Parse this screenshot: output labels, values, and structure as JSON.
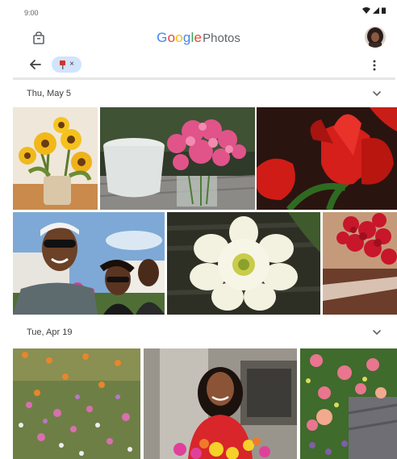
{
  "status_bar": {
    "time": "9:00"
  },
  "app_bar": {
    "logo_letters": [
      {
        "char": "G",
        "color": "#4285F4"
      },
      {
        "char": "o",
        "color": "#EA4335"
      },
      {
        "char": "o",
        "color": "#FBBC05"
      },
      {
        "char": "g",
        "color": "#4285F4"
      },
      {
        "char": "l",
        "color": "#34A853"
      },
      {
        "char": "e",
        "color": "#EA4335"
      }
    ],
    "logo_suffix": "Photos"
  },
  "filter_chip": {
    "icon": "pin-icon",
    "remove": "×"
  },
  "sections": [
    {
      "date": "Thu, May 5",
      "photos": [
        "sunflowers",
        "pink-flowers-in-pot",
        "red-tulips",
        "selfie-group",
        "white-flower",
        "red-roses"
      ]
    },
    {
      "date": "Tue, Apr 19",
      "photos": [
        "flower-field",
        "woman-with-flowers",
        "rose-garden"
      ]
    }
  ],
  "colors": {
    "accent": "#4285F4",
    "chip_bg": "#d2e3fc",
    "divider": "#e6e6e6"
  }
}
